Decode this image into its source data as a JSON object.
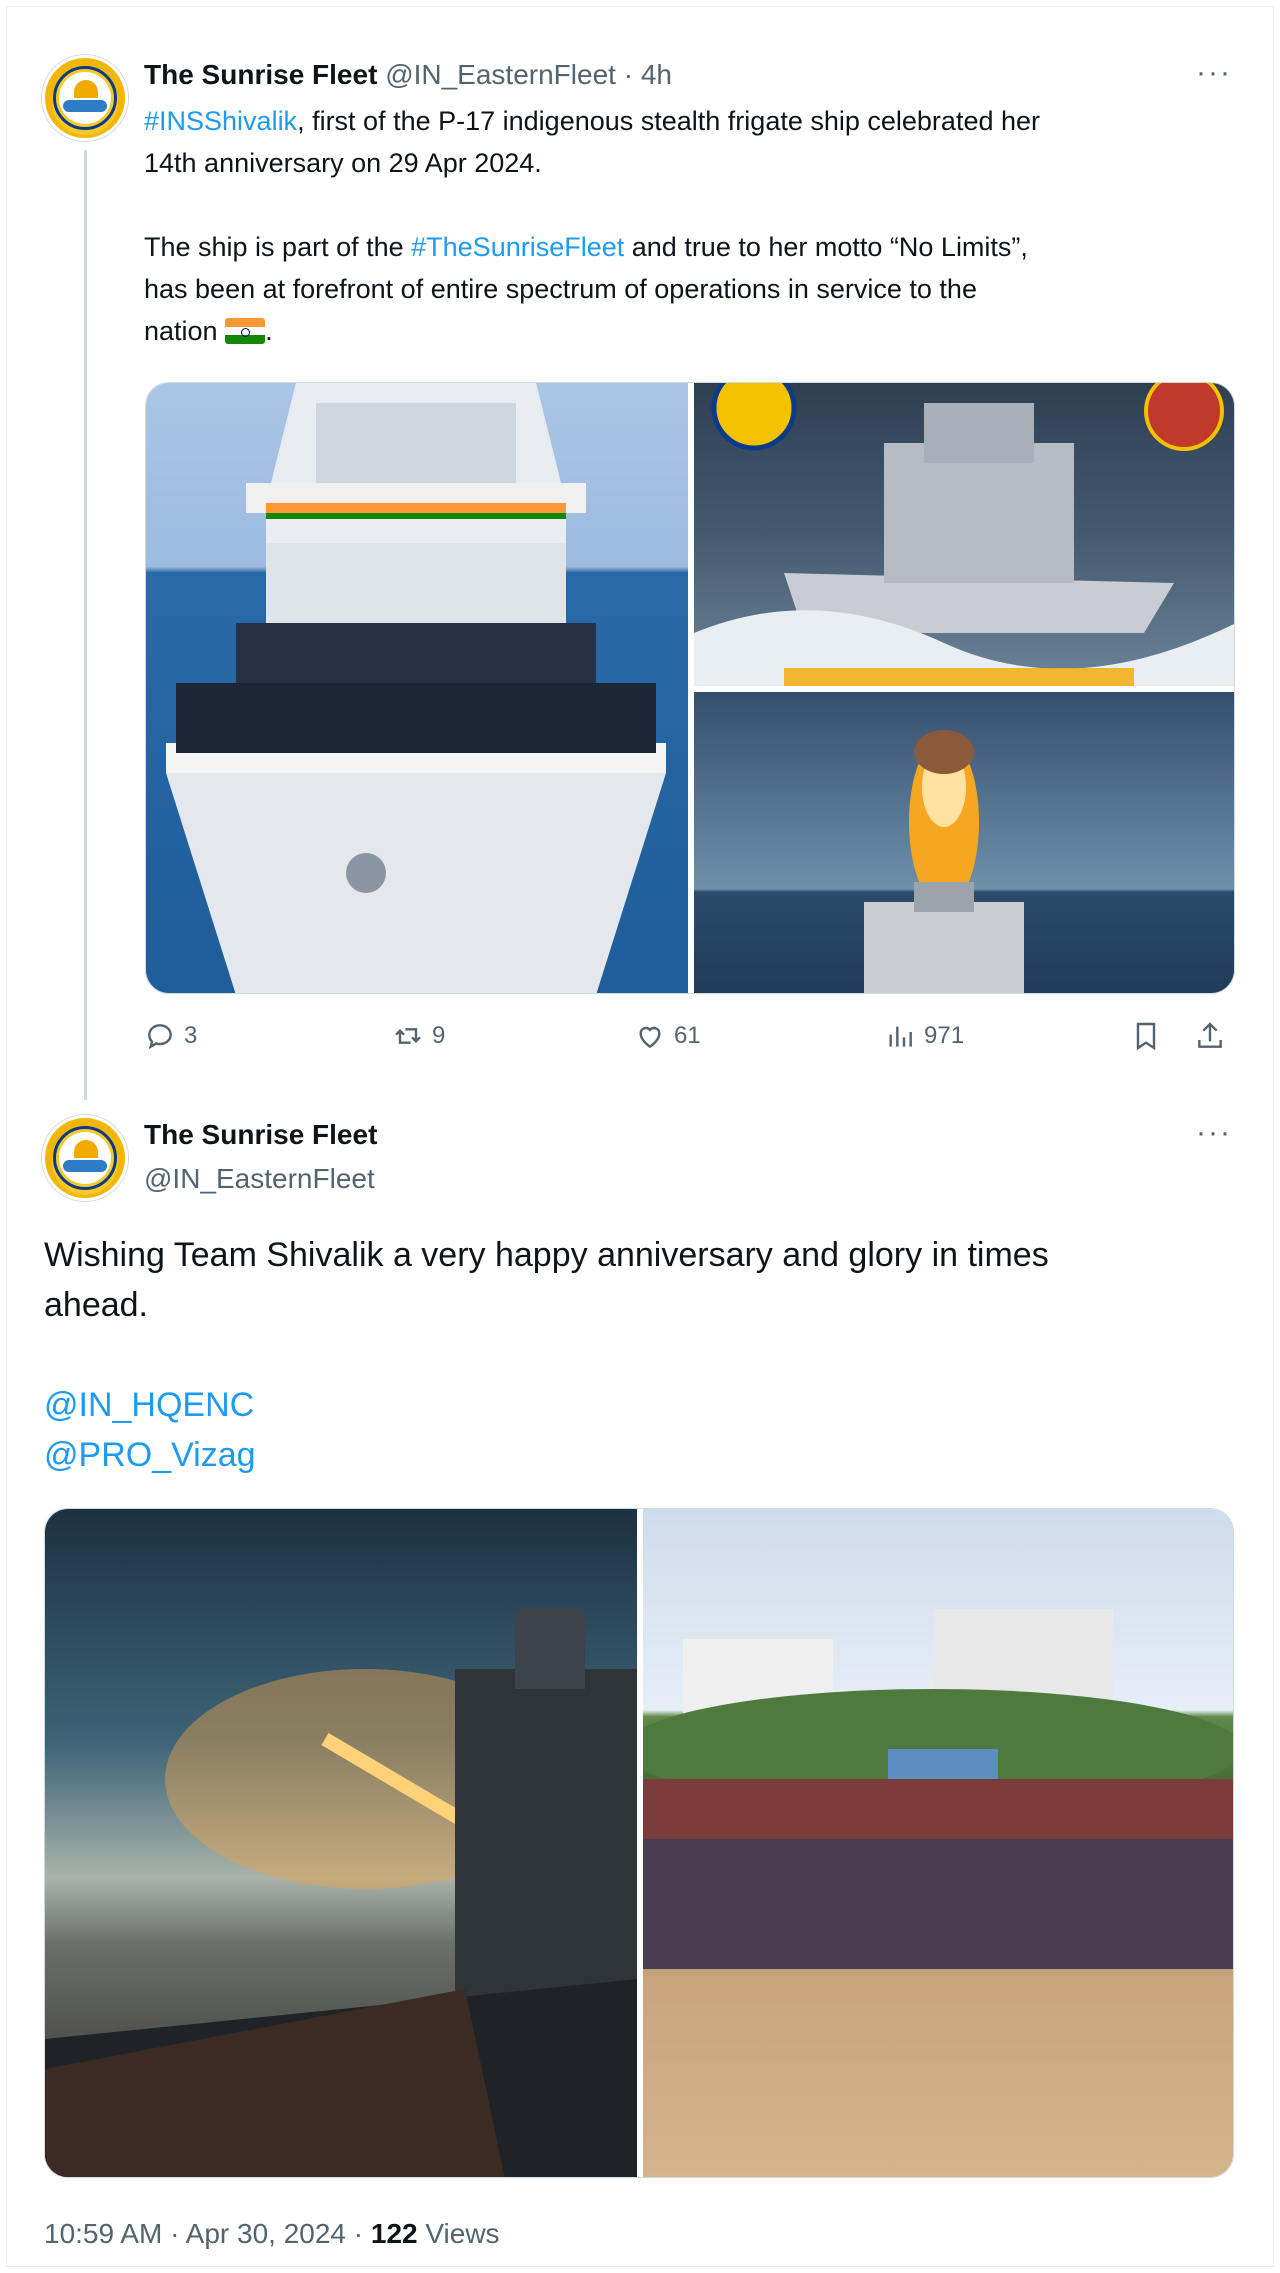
{
  "tweet1": {
    "display_name": "The Sunrise Fleet",
    "handle": "@IN_EasternFleet",
    "separator": "·",
    "time_ago": "4h",
    "more_label": "···",
    "hashtag_1": "#INSShivalik",
    "text_a": ", first of the P-17 indigenous stealth frigate ship celebrated her",
    "text_b": "14th anniversary on 29 Apr 2024.",
    "text_c": "The ship is part of the ",
    "hashtag_2": "#TheSunriseFleet",
    "text_d": " and true to her motto “No Limits”,",
    "text_e": "has been at forefront of entire spectrum of operations in service to the",
    "text_f": "nation ",
    "text_g": ".",
    "images": [
      "ship-crew-photo",
      "frigate-at-sea-photo",
      "missile-launch-photo"
    ],
    "stats": {
      "replies": "3",
      "reposts": "9",
      "likes": "61",
      "views": "971"
    }
  },
  "tweet2": {
    "display_name": "The Sunrise Fleet",
    "handle": "@IN_EasternFleet",
    "more_label": "···",
    "text_line1": "Wishing Team Shivalik a very happy anniversary and glory in times",
    "text_line2": "ahead.",
    "mention_1": "@IN_HQENC",
    "mention_2": "@PRO_Vizag",
    "images": [
      "rocket-firing-photo",
      "group-photo"
    ],
    "timestamp": "10:59 AM · Apr 30, 2024 · ",
    "views_count": "122",
    "views_label": " Views"
  },
  "colors": {
    "link": "#1d9bf0",
    "text": "#0f1419",
    "muted": "#536471",
    "thread_line": "#cfd9de"
  }
}
